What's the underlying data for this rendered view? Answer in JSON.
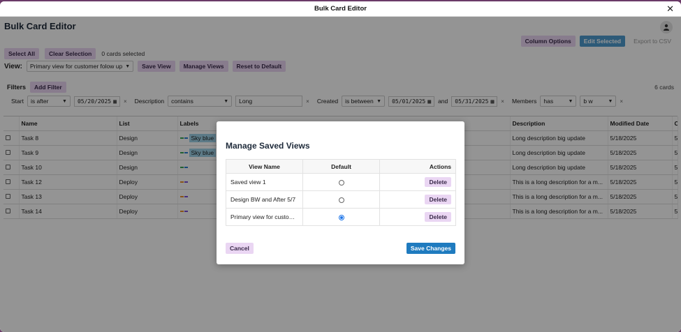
{
  "window": {
    "title": "Bulk Card Editor",
    "close": "✕"
  },
  "app": {
    "title": "Bulk Card Editor"
  },
  "toolbar": {
    "column_options": "Column Options",
    "edit_selected": "Edit Selected",
    "export_csv": "Export to CSV",
    "select_all": "Select All",
    "clear_selection": "Clear Selection",
    "selected_count": "0 cards selected"
  },
  "view": {
    "label": "View:",
    "selected": "Primary view for customer folow up",
    "save": "Save View",
    "manage": "Manage Views",
    "reset": "Reset to Default"
  },
  "filters": {
    "label": "Filters",
    "add": "Add Filter",
    "cards_count": "6 cards",
    "start_label": "Start",
    "start_op": "is after",
    "start_value": "05/20/2025",
    "desc_label": "Description",
    "desc_op": "contains",
    "desc_value": "Long",
    "created_label": "Created",
    "created_op": "is between",
    "created_from": "05/01/2025",
    "and_label": "and",
    "created_to": "05/31/2025",
    "members_label": "Members",
    "members_op": "has",
    "members_value": "b w",
    "clear": "×"
  },
  "grid": {
    "headers": [
      "Name",
      "List",
      "Labels",
      "Description",
      "Modified Date",
      "Cr"
    ],
    "rows": [
      {
        "name": "Task 8",
        "list": "Design",
        "label": "Sky blue",
        "desc": "Long description big update",
        "modified": "5/18/2025",
        "cr": "5/"
      },
      {
        "name": "Task 9",
        "list": "Design",
        "label": "Sky blue",
        "desc": "Long description big update",
        "modified": "5/18/2025",
        "cr": "5/"
      },
      {
        "name": "Task 10",
        "list": "Design",
        "label": "",
        "desc": "Long description big update",
        "modified": "5/18/2025",
        "cr": "5/"
      },
      {
        "name": "Task 12",
        "list": "Deploy",
        "label": "",
        "desc": "This is a long description for a m...",
        "modified": "5/18/2025",
        "cr": "5/"
      },
      {
        "name": "Task 13",
        "list": "Deploy",
        "label": "",
        "desc": "This is a long description for a m...",
        "modified": "5/18/2025",
        "cr": "5/"
      },
      {
        "name": "Task 14",
        "list": "Deploy",
        "label": "",
        "desc": "This is a long description for a m...",
        "modified": "5/18/2025",
        "cr": "5/"
      }
    ]
  },
  "modal": {
    "title": "Manage Saved Views",
    "headers": {
      "name": "View Name",
      "default": "Default",
      "actions": "Actions"
    },
    "rows": [
      {
        "name": "Saved view 1",
        "default": false,
        "action": "Delete"
      },
      {
        "name": "Design BW and After 5/7",
        "default": false,
        "action": "Delete"
      },
      {
        "name": "Primary view for custom...",
        "default": true,
        "action": "Delete"
      }
    ],
    "cancel": "Cancel",
    "save": "Save Changes"
  },
  "colors": {
    "accent": "#1f7bbf",
    "button_bg": "#ead6f3",
    "selected_blue": "#4e9ccf",
    "window_frame": "#6b3a68"
  }
}
